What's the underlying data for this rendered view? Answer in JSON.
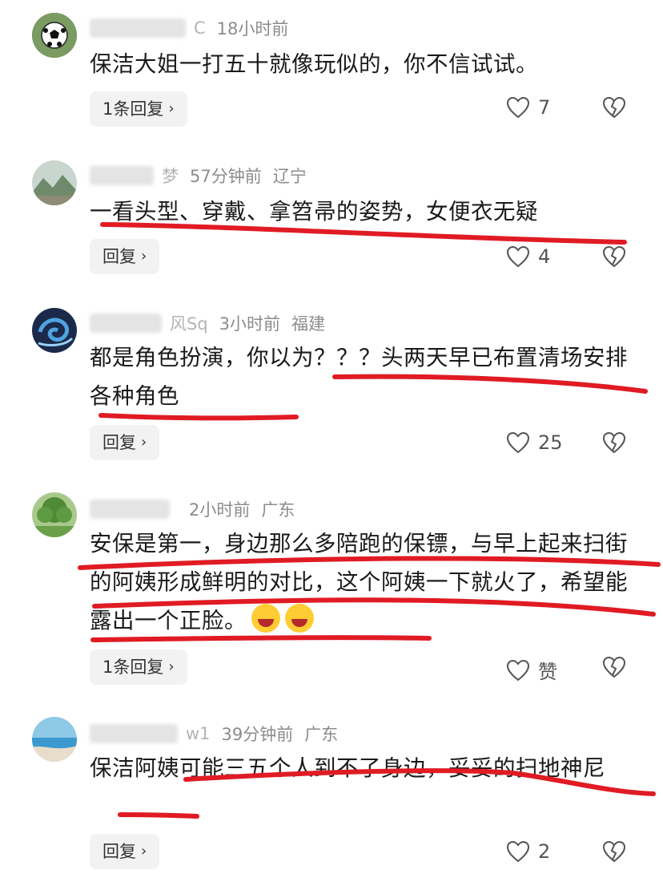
{
  "comments": [
    {
      "name_tail": "C",
      "time": "18小时前",
      "location": "",
      "text": "保洁大姐一打五十就像玩似的，你不信试试。",
      "reply_label": "1条回复",
      "likes": "7",
      "avatar": "soccer-ball"
    },
    {
      "name_tail": "梦",
      "time": "57分钟前",
      "location": "辽宁",
      "text": "一看头型、穿戴、拿笤帚的姿势，女便衣无疑",
      "reply_label": "回复",
      "likes": "4",
      "avatar": "landscape"
    },
    {
      "name_tail": "风Sq",
      "time": "3小时前",
      "location": "福建",
      "text": "都是角色扮演，你以为？？？头两天早已布置清场安排各种角色",
      "reply_label": "回复",
      "likes": "25",
      "avatar": "blue-swirl"
    },
    {
      "name_tail": "",
      "time": "2小时前",
      "location": "广东",
      "text": "安保是第一，身边那么多陪跑的保镖，与早上起来扫街的阿姨形成鲜明的对比，这个阿姨一下就火了，希望能露出一个正脸。",
      "reply_label": "1条回复",
      "likes": "赞",
      "avatar": "green-tree"
    },
    {
      "name_tail": "w1",
      "time": "39分钟前",
      "location": "广东",
      "text": "保洁阿姨可能三五个人到不了身边，妥妥的扫地神尼",
      "reply_label": "回复",
      "likes": "2",
      "avatar": "beach"
    }
  ],
  "colors": {
    "annotation_red": "#e01b24",
    "meta_gray": "#8c8c8c",
    "reply_bg": "#f2f2f2"
  }
}
